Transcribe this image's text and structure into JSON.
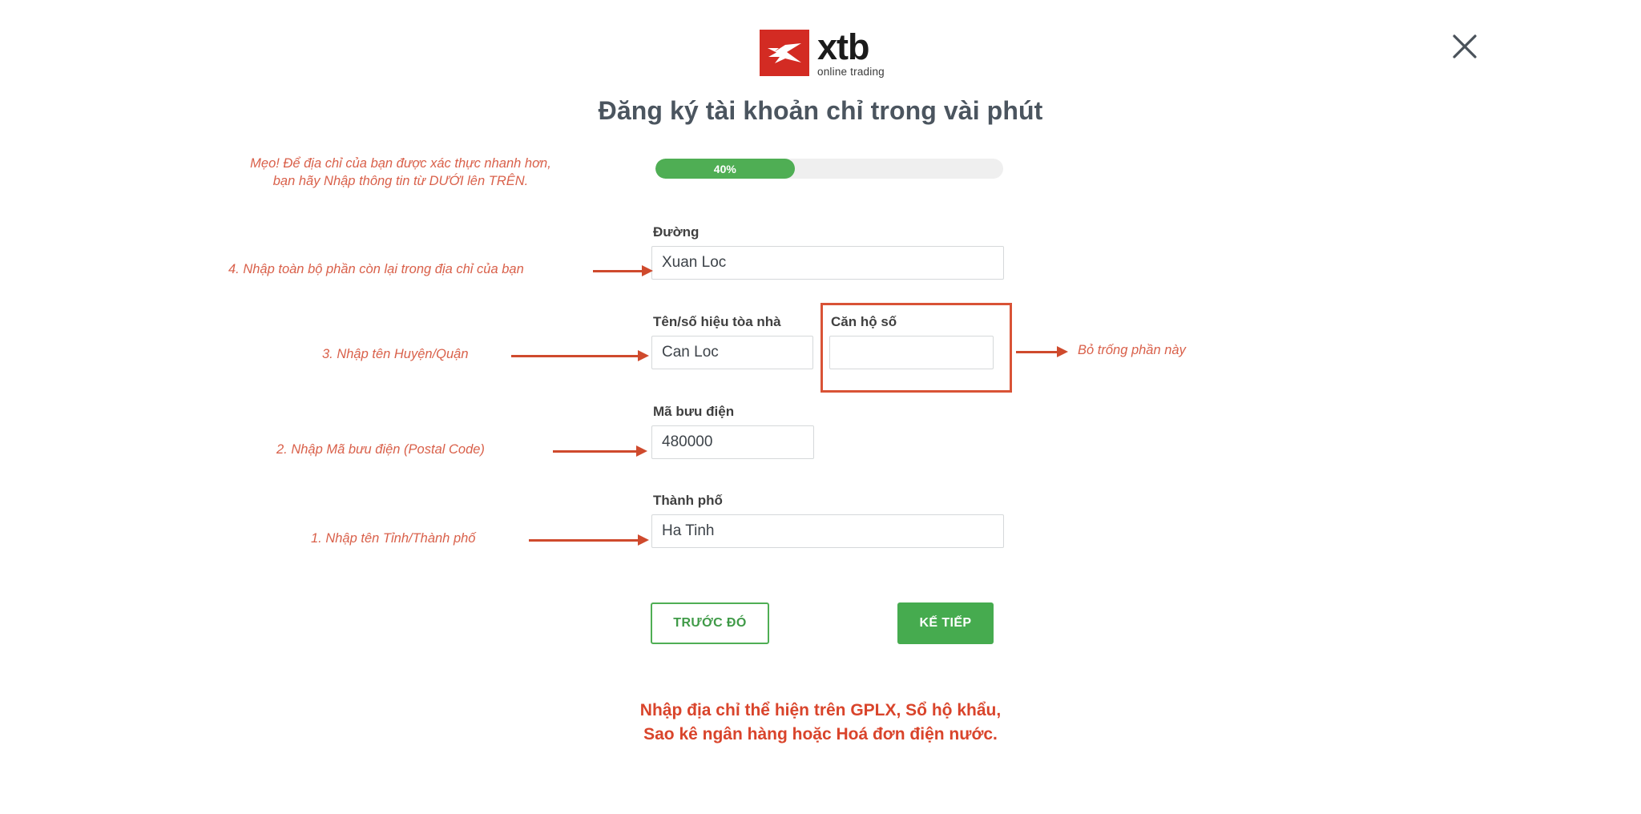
{
  "window": {
    "close_icon": "close-icon"
  },
  "brand": {
    "logo_mark": "xtb-logo-mark",
    "name": "xtb",
    "tagline": "online trading",
    "mark_color": "#d32b23"
  },
  "header": {
    "title": "Đăng ký tài khoản chỉ trong vài phút"
  },
  "progress": {
    "percent_label": "40%",
    "percent_value": 40,
    "fill_color": "#4fae54",
    "track_color": "#efefef"
  },
  "tip": {
    "line1": "Mẹo! Để địa chỉ của bạn được xác thực nhanh hơn,",
    "line2": "bạn hãy Nhập thông tin từ DƯỚI lên TRÊN.",
    "color": "#d9604a"
  },
  "form": {
    "street": {
      "label": "Đường",
      "value": "Xuan Loc",
      "placeholder": ""
    },
    "building": {
      "label": "Tên/số hiệu tòa nhà",
      "value": "Can Loc",
      "placeholder": ""
    },
    "flat": {
      "label": "Căn hộ số",
      "value": "",
      "placeholder": ""
    },
    "postal": {
      "label": "Mã bưu điện",
      "value": "480000",
      "placeholder": ""
    },
    "city": {
      "label": "Thành phố",
      "value": "Ha Tinh",
      "placeholder": ""
    }
  },
  "annotations": {
    "step4": "4.  Nhập toàn bộ phần còn lại trong địa chỉ của bạn",
    "step3": "3. Nhập tên Huyện/Quận",
    "step2": "2. Nhập Mã bưu điện (Postal Code)",
    "step1": "1. Nhập tên Tỉnh/Thành phố",
    "leave_blank": "Bỏ trống phần này",
    "highlight_color": "#d95336",
    "arrow_color": "#cf4a2d"
  },
  "buttons": {
    "previous": "TRƯỚC ĐÓ",
    "next": "KẾ TIẾP",
    "accent_color": "#46ab4f"
  },
  "notice": {
    "line1": "Nhập địa chỉ thể hiện trên GPLX, Sổ hộ khẩu,",
    "line2": "Sao kê ngân hàng hoặc Hoá đơn điện nước.",
    "color": "#d9442b"
  }
}
